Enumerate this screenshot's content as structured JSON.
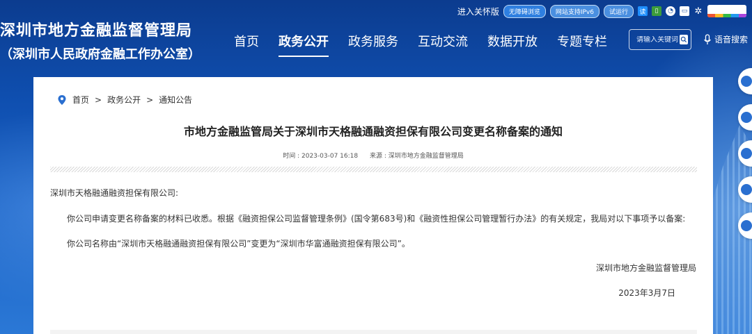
{
  "util": {
    "care_version": "进入关怀版",
    "accessibility": "无障碍浏览",
    "ipv6": "网站支持IPv6",
    "trial": "试运行"
  },
  "site": {
    "title": "深圳市地方金融监督管理局",
    "subtitle": "（深圳市人民政府金融工作办公室）"
  },
  "nav": [
    {
      "label": "首页",
      "active": false
    },
    {
      "label": "政务公开",
      "active": true
    },
    {
      "label": "政务服务",
      "active": false
    },
    {
      "label": "互动交流",
      "active": false
    },
    {
      "label": "数据开放",
      "active": false
    },
    {
      "label": "专题专栏",
      "active": false
    }
  ],
  "search": {
    "placeholder": "请输入关键词"
  },
  "voice": {
    "label": "语音搜索"
  },
  "breadcrumb": {
    "home": "首页",
    "sep": ">",
    "level1": "政务公开",
    "level2": "通知公告"
  },
  "article": {
    "title": "市地方金融监管局关于深圳市天格融通融资担保有限公司变更名称备案的通知",
    "time": "时间 : 2023-03-07 16:18",
    "source": "来源 : 深圳市地方金融监督管理局",
    "salutation": "深圳市天格融通融资担保有限公司:",
    "para1": "你公司申请变更名称备案的材料已收悉。根据《融资担保公司监督管理条例》(国令第683号)和《融资性担保公司管理暂行办法》的有关规定，我局对以下事项予以备案:",
    "para2": "你公司名称由“深圳市天格融通融资担保有限公司”变更为“深圳市华富通融资担保有限公司”。",
    "signature": "深圳市地方金融监督管理局",
    "date": "2023年3月7日"
  },
  "colors": {
    "header_bg": "#0f4fb0",
    "card_bg": "#ffffff",
    "accent": "#2a6fd0"
  }
}
